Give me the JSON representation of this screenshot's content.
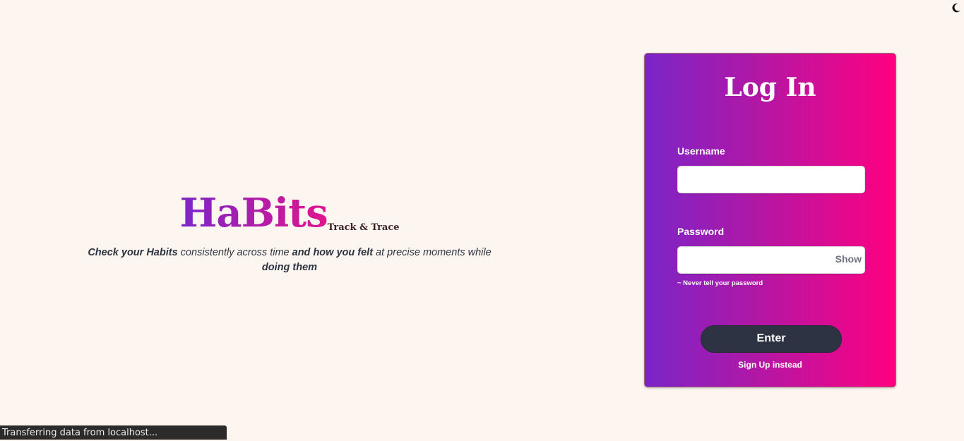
{
  "theme_toggle": {
    "icon": "moon-icon"
  },
  "brand": {
    "title": "HaBits",
    "subtitle": "Track & Trace",
    "tagline": {
      "part1": "Check your Habits",
      "part2": " consistently across time ",
      "part3": "and how you felt",
      "part4": " at precise moments while ",
      "part5": "doing them"
    },
    "gradient": [
      "#7b26c9",
      "#e0158e"
    ]
  },
  "login": {
    "title": "Log In",
    "username_label": "Username",
    "username_value": "",
    "password_label": "Password",
    "password_value": "",
    "show_label": "Show",
    "hint": "~ Never tell your password",
    "enter_label": "Enter",
    "signup_label": "Sign Up instead",
    "gradient": [
      "#7a25c8",
      "#ff0080"
    ],
    "button_color": "#2d3342"
  },
  "status_bar": {
    "text": "Transferring data from localhost..."
  }
}
